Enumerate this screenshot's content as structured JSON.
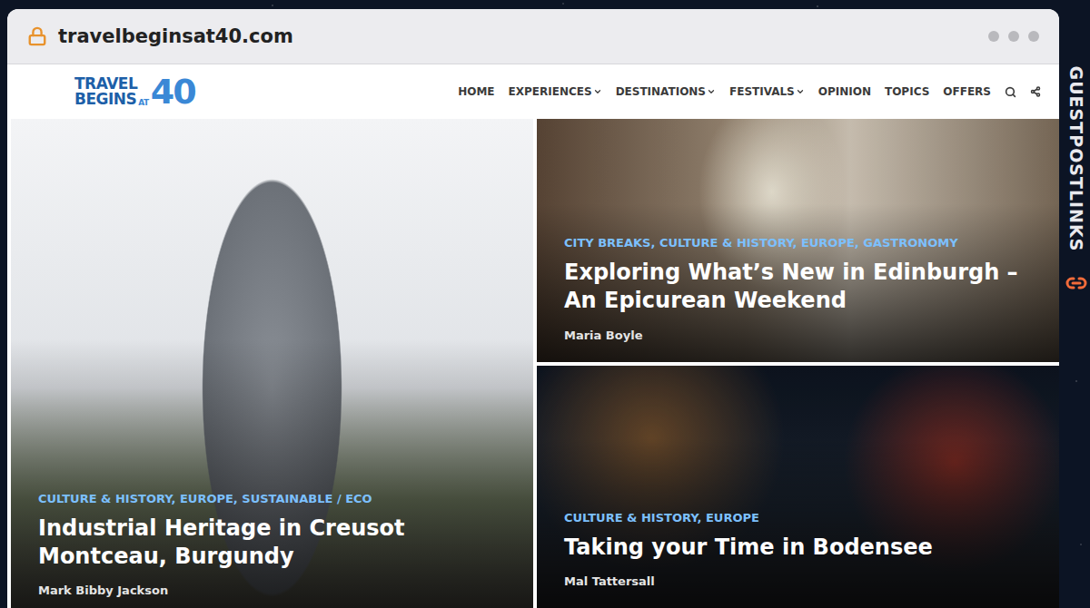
{
  "browser": {
    "url": "travelbeginsat40.com",
    "secure": true
  },
  "logo": {
    "line1": "TRAVEL",
    "line2": "BEGINS",
    "small": "AT",
    "number": "40"
  },
  "nav": [
    {
      "label": "HOME",
      "dropdown": false
    },
    {
      "label": "EXPERIENCES",
      "dropdown": true
    },
    {
      "label": "DESTINATIONS",
      "dropdown": true
    },
    {
      "label": "FESTIVALS",
      "dropdown": true
    },
    {
      "label": "OPINION",
      "dropdown": false
    },
    {
      "label": "TOPICS",
      "dropdown": false
    },
    {
      "label": "OFFERS",
      "dropdown": false
    }
  ],
  "articles": [
    {
      "categories": "CULTURE & HISTORY, EUROPE, SUSTAINABLE / ECO",
      "title": "Industrial Heritage in Creusot Montceau, Burgundy",
      "author": "Mark Bibby Jackson",
      "featured": true
    },
    {
      "categories": "CITY BREAKS, CULTURE & HISTORY, EUROPE, GASTRONOMY",
      "title": "Exploring What’s New in Edinburgh – An Epicurean Weekend",
      "author": "Maria Boyle",
      "featured": false
    },
    {
      "categories": "CULTURE & HISTORY, EUROPE",
      "title": "Taking your Time in Bodensee",
      "author": "Mal Tattersall",
      "featured": false
    }
  ],
  "watermark": "GUESTPOSTLINKS"
}
